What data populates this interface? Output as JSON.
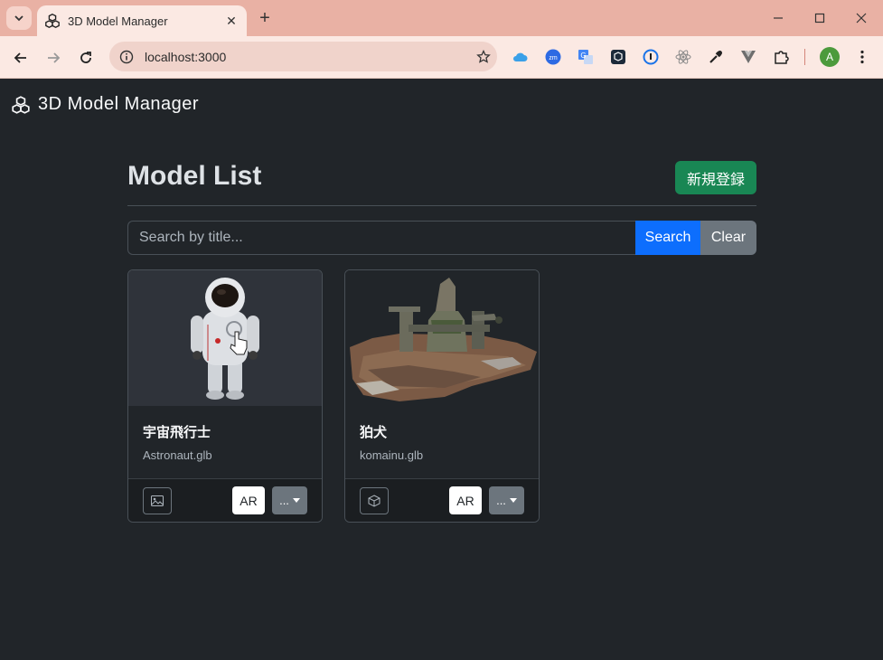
{
  "browser": {
    "tab_title": "3D Model Manager",
    "url": "localhost:3000",
    "profile_initial": "A",
    "extensions": [
      "cloud-icon",
      "zoom-icon",
      "translate-icon",
      "cube-ext-icon",
      "password-icon",
      "react-icon",
      "eyedropper-icon",
      "vue-icon",
      "puzzle-icon"
    ]
  },
  "app": {
    "brand": "3D Model Manager",
    "page_title": "Model List",
    "new_button": "新規登録",
    "search": {
      "placeholder": "Search by title...",
      "value": "",
      "search_label": "Search",
      "clear_label": "Clear"
    },
    "models": [
      {
        "title": "宇宙飛行士",
        "file": "Astronaut.glb",
        "thumb_icon": "image-icon",
        "ar_label": "AR",
        "more_label": "..."
      },
      {
        "title": "狛犬",
        "file": "komainu.glb",
        "thumb_icon": "box-icon",
        "ar_label": "AR",
        "more_label": "..."
      }
    ]
  },
  "colors": {
    "success": "#198754",
    "primary": "#0d6efd",
    "secondary": "#6c757d",
    "background": "#212529"
  }
}
